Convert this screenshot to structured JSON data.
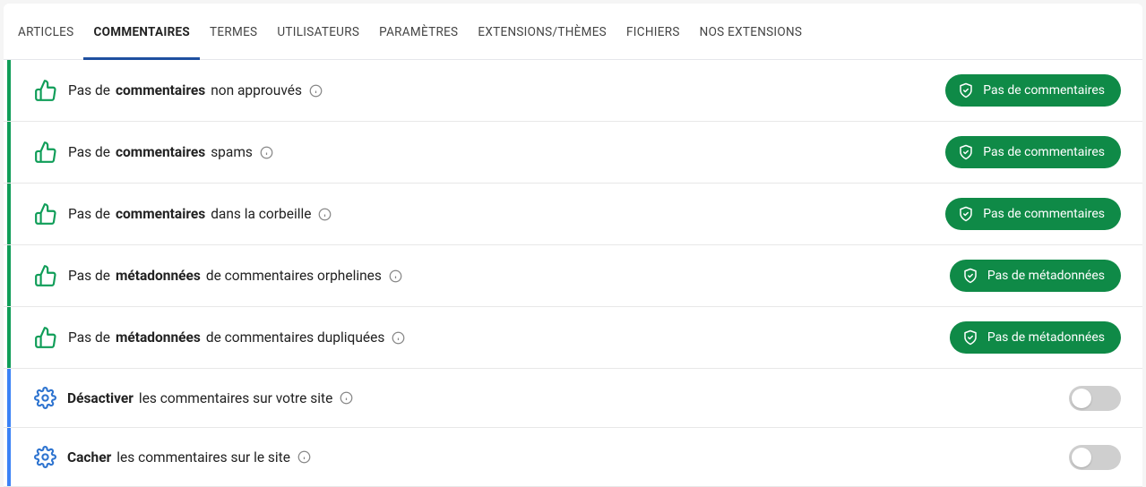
{
  "tabs": [
    {
      "label": "ARTICLES"
    },
    {
      "label": "COMMENTAIRES"
    },
    {
      "label": "TERMES"
    },
    {
      "label": "UTILISATEURS"
    },
    {
      "label": "PARAMÈTRES"
    },
    {
      "label": "EXTENSIONS/THÈMES"
    },
    {
      "label": "FICHIERS"
    },
    {
      "label": "NOS EXTENSIONS"
    }
  ],
  "active_tab_index": 1,
  "rows": [
    {
      "type": "status",
      "prefix": "Pas de",
      "bold": "commentaires",
      "suffix": "non approuvés",
      "badge": "Pas de commentaires"
    },
    {
      "type": "status",
      "prefix": "Pas de",
      "bold": "commentaires",
      "suffix": "spams",
      "badge": "Pas de commentaires"
    },
    {
      "type": "status",
      "prefix": "Pas de",
      "bold": "commentaires",
      "suffix": "dans la corbeille",
      "badge": "Pas de commentaires"
    },
    {
      "type": "status",
      "prefix": "Pas de",
      "bold": "métadonnées",
      "suffix": "de commentaires orphelines",
      "badge": "Pas de métadonnées"
    },
    {
      "type": "status",
      "prefix": "Pas de",
      "bold": "métadonnées",
      "suffix": "de commentaires dupliquées",
      "badge": "Pas de métadonnées"
    },
    {
      "type": "setting",
      "bold": "Désactiver",
      "suffix": "les commentaires sur votre site",
      "toggle": false
    },
    {
      "type": "setting",
      "bold": "Cacher",
      "suffix": "les commentaires sur le site",
      "toggle": false
    }
  ]
}
